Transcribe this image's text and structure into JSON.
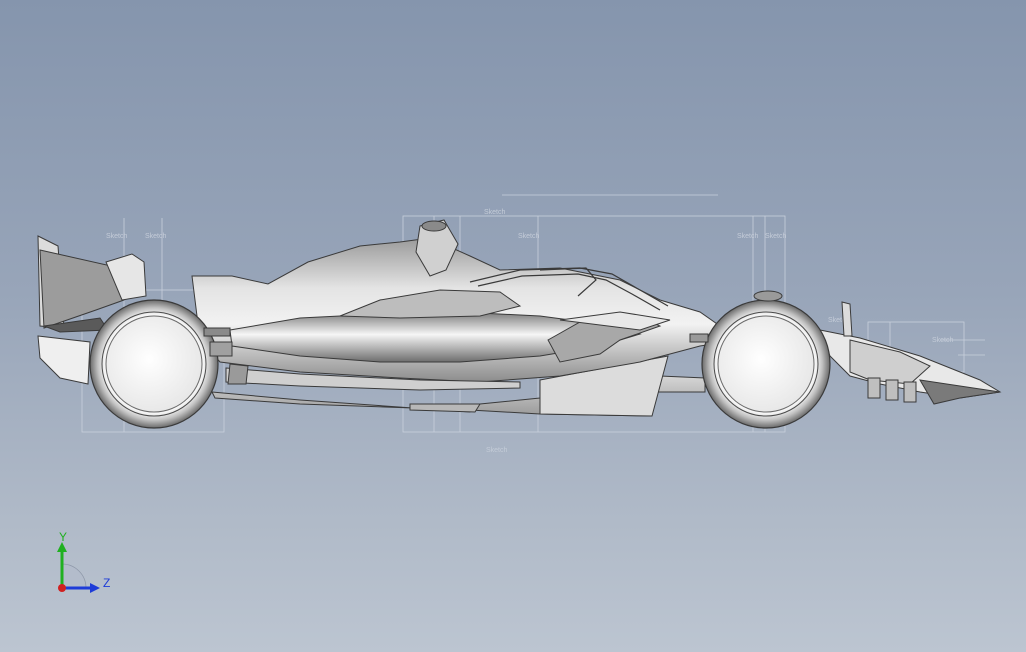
{
  "viewport": {
    "background_top": "#8595ad",
    "background_bottom": "#bcc5d1"
  },
  "model": {
    "body_color": "#c8c8c8",
    "edge_color": "#3a3a3a",
    "sketch_line_color": "#c9d0dc"
  },
  "triad": {
    "y_label": "Y",
    "z_label": "Z",
    "y_color": "#20b020",
    "z_color": "#1e3cd8",
    "x_color": "#d02020"
  }
}
